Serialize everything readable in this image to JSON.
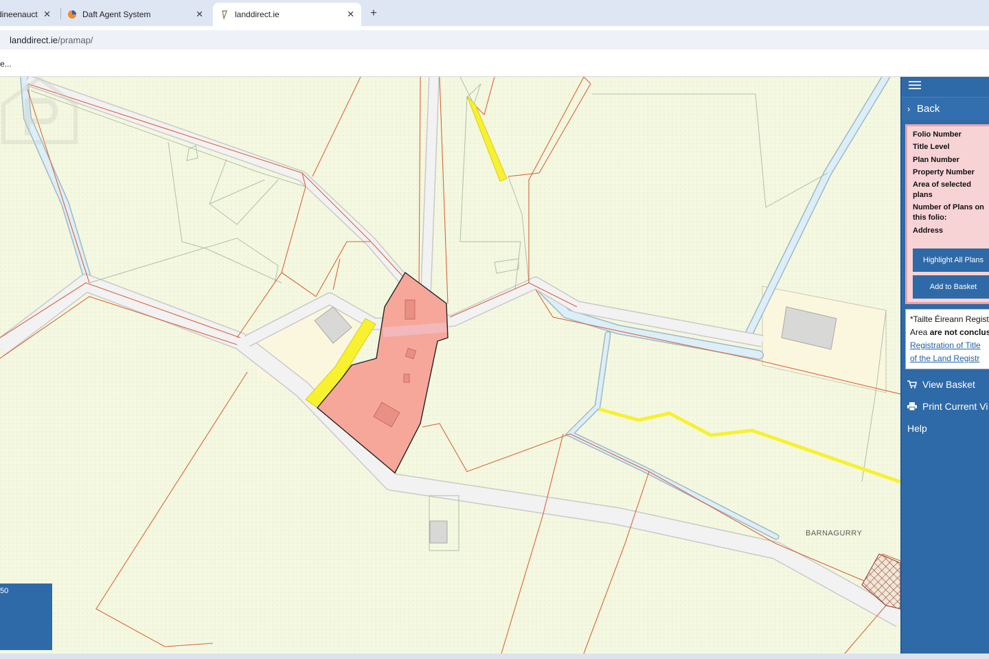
{
  "browser": {
    "tabs": [
      {
        "label": "dineenauct",
        "active": false
      },
      {
        "label": "Daft Agent System",
        "active": false
      },
      {
        "label": "landdirect.ie",
        "active": true
      }
    ],
    "close_glyph": "✕",
    "new_tab_glyph": "+",
    "url_host": "landdirect.ie",
    "url_path": "/pramap/",
    "bookmark": "e..."
  },
  "map": {
    "townland_label": "BARNAGURRY",
    "scale_text": "50",
    "colors": {
      "background": "#f4f8e0",
      "boundary": "#d9633b",
      "selected_plan": "#f6a79a",
      "highlight": "#f7f130",
      "road": "#f2f2f2",
      "river": "#cfe4f0"
    }
  },
  "panel": {
    "back_label": "Back",
    "fields": [
      "Folio Number",
      "Title Level",
      "Plan Number",
      "Property Number",
      "Area of selected plans",
      "Number of Plans on this folio:",
      "Address"
    ],
    "highlight_button": "Highlight All Plans",
    "basket_button": "Add to Basket",
    "notice": {
      "line1": "*Tailte Éireann Regist",
      "line2_prefix": "Area ",
      "line2_bold": "are not conclus",
      "link1": "Registration of Title",
      "link2": "of the Land Registr"
    },
    "view_basket": "View Basket",
    "print_view": "Print Current Vi",
    "help": "Help",
    "colors": {
      "panel": "#2f6aa8",
      "info_box": "#f7d3d6"
    }
  }
}
